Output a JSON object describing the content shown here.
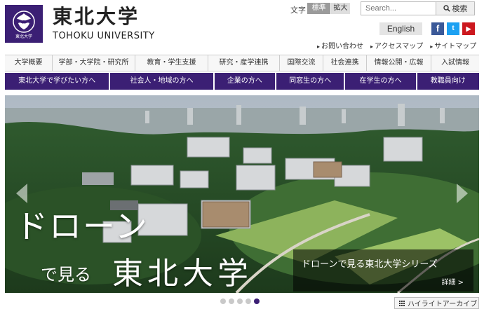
{
  "header": {
    "logo_caption": "東北大学",
    "university_name_jp": "東北大学",
    "university_name_en": "TOHOKU UNIVERSITY",
    "font_size_label": "文字",
    "font_size_standard": "標準",
    "font_size_large": "拡大",
    "search_placeholder": "Search...",
    "search_button": "検索",
    "english_link": "English",
    "sns": {
      "facebook": "f",
      "twitter": "t",
      "youtube": "▶"
    },
    "util_links": [
      "お問い合わせ",
      "アクセスマップ",
      "サイトマップ"
    ]
  },
  "nav_primary": [
    "大学概要",
    "学部・大学院・研究所",
    "教育・学生支援",
    "研究・産学連携",
    "国際交流",
    "社会連携",
    "情報公開・広報",
    "入試情報"
  ],
  "nav_audience": [
    "東北大学で学びたい方へ",
    "社会人・地域の方へ",
    "企業の方へ",
    "同窓生の方へ",
    "在学生の方へ",
    "教職員向け"
  ],
  "hero": {
    "headline_1": "ドローン",
    "headline_2": "で見る",
    "headline_3": "東北大学",
    "caption_title": "ドローンで見る東北大学シリーズ",
    "caption_more": "詳細 >"
  },
  "carousel": {
    "slides": 5,
    "active_index": 4
  },
  "archive_button": "ハイライトアーカイブ",
  "colors": {
    "brand_purple": "#3b1f74"
  },
  "icons": [
    "search-icon",
    "chevron-left-icon",
    "chevron-right-icon",
    "grid-icon",
    "facebook-icon",
    "twitter-icon",
    "youtube-icon"
  ]
}
